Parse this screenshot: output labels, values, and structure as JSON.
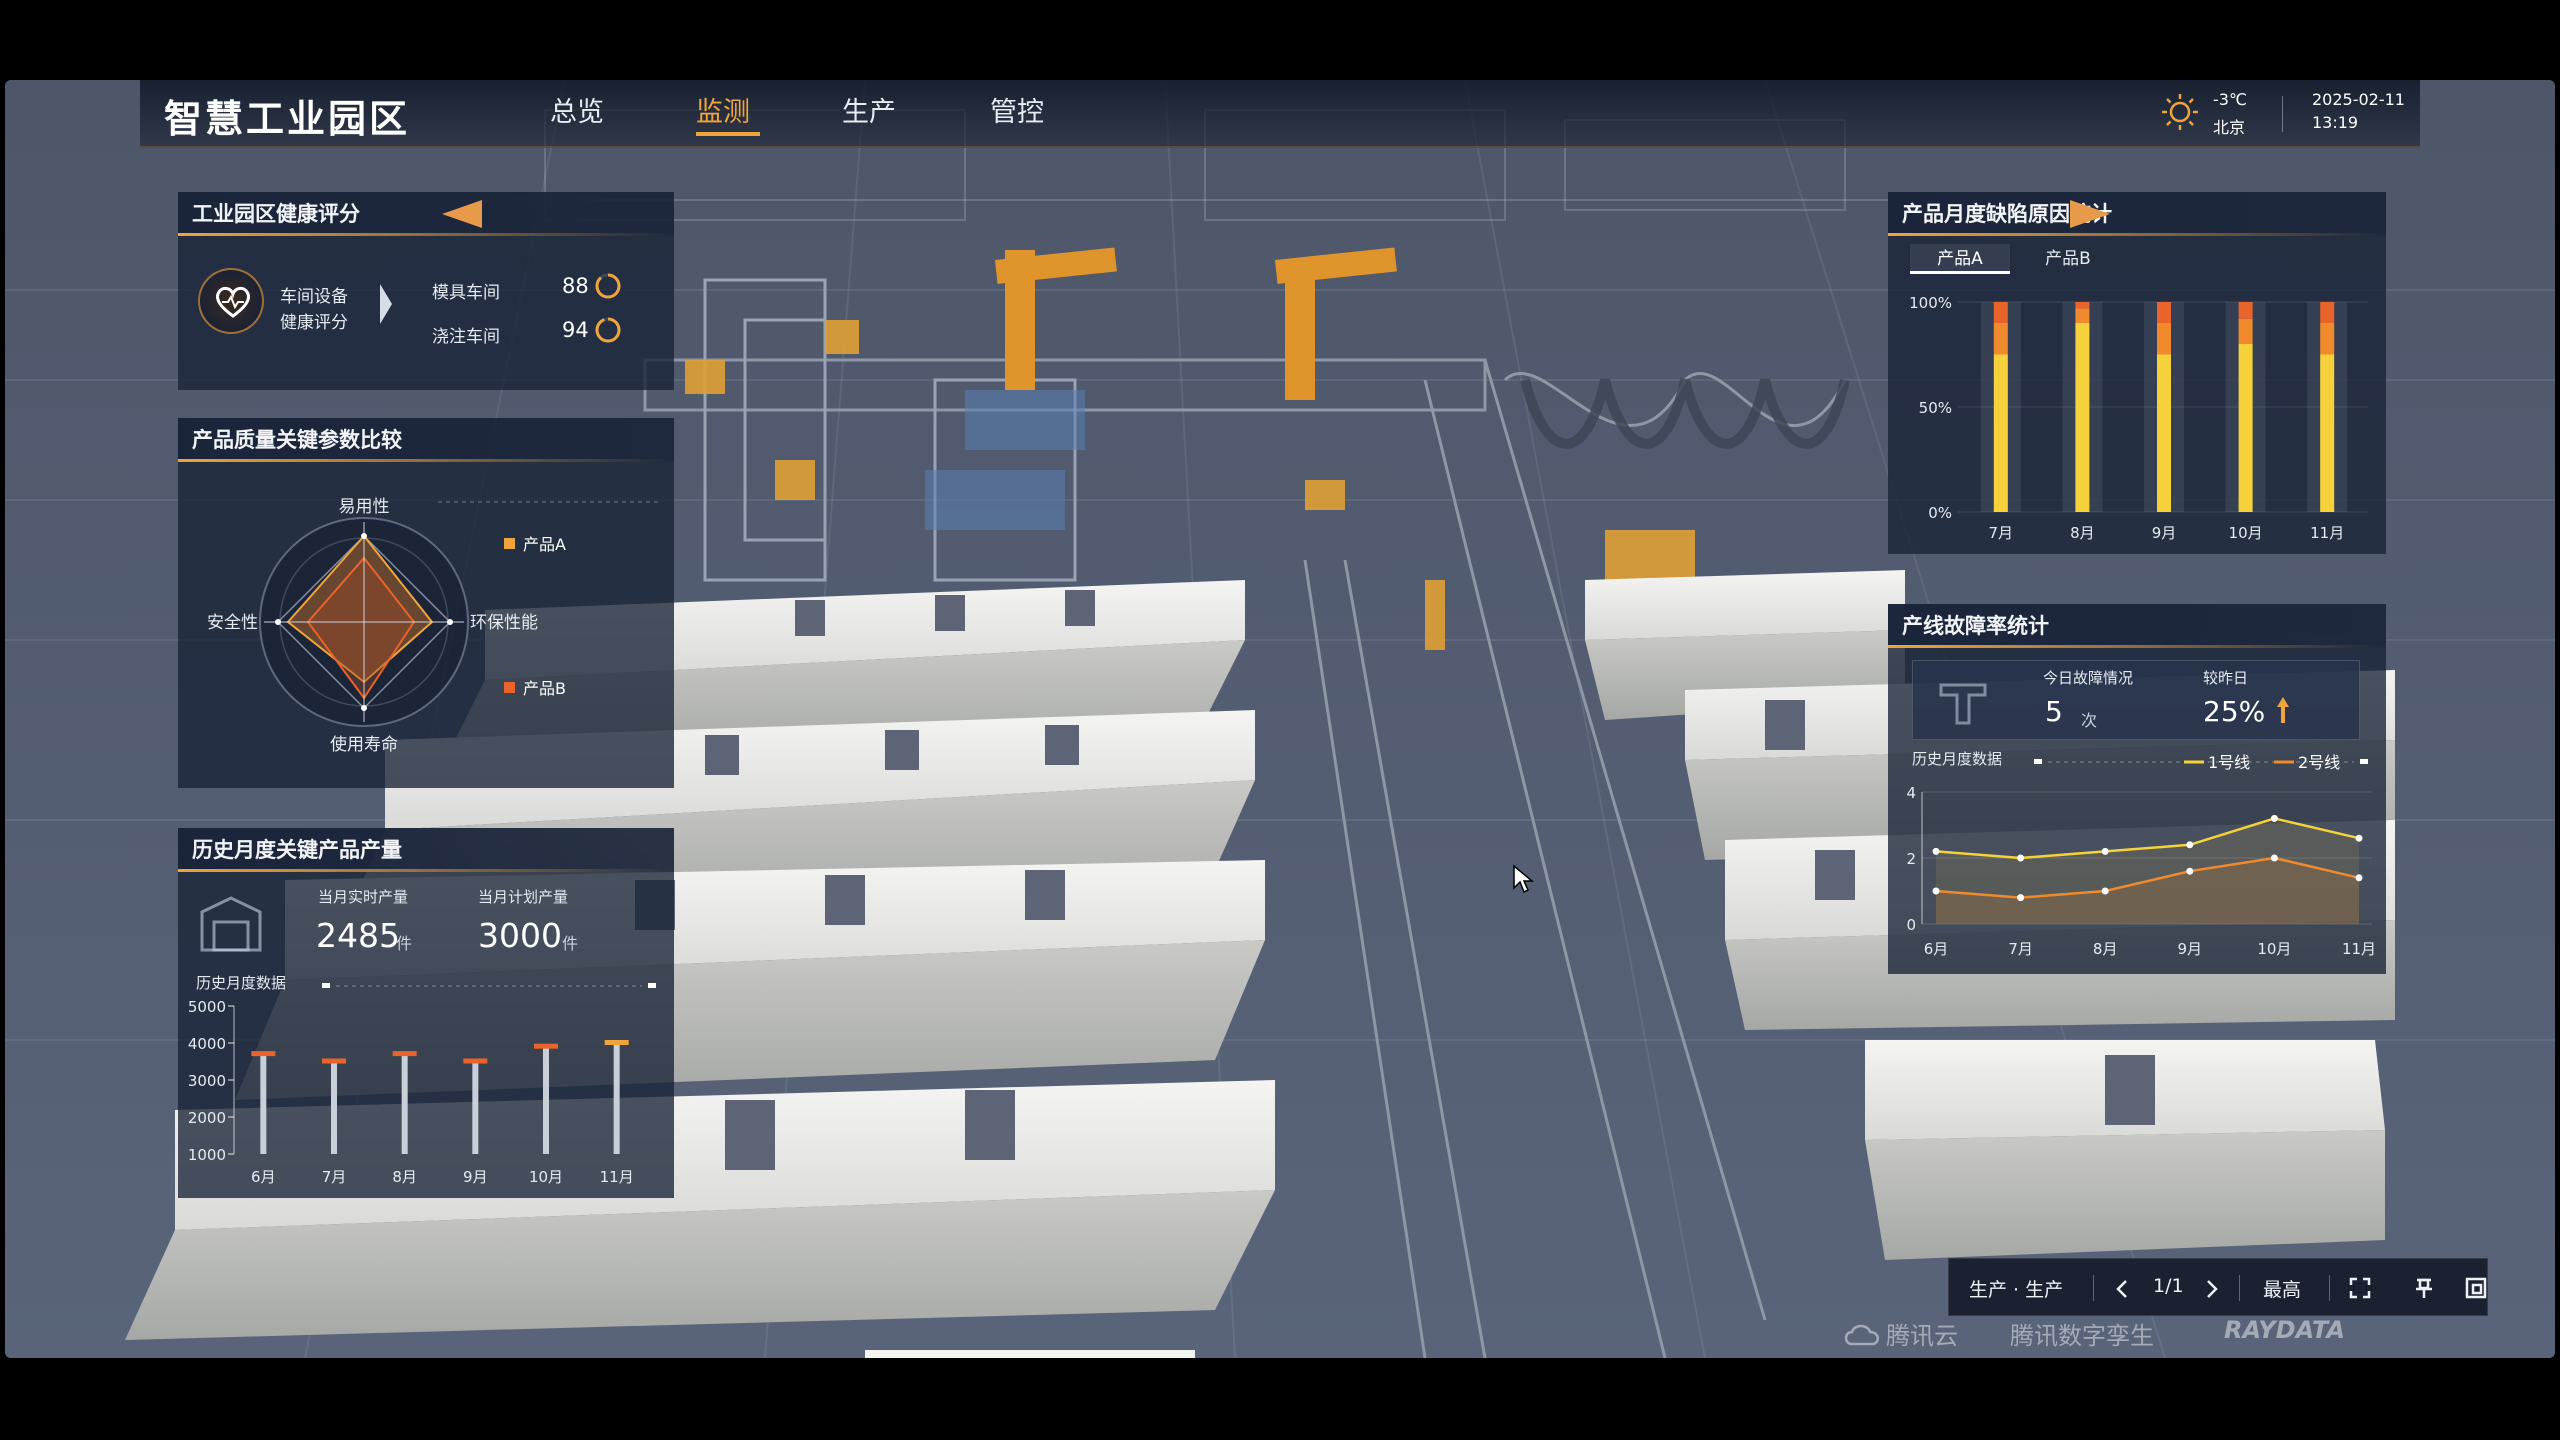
{
  "header": {
    "title": "智慧工业园区",
    "nav": [
      "总览",
      "监测",
      "生产",
      "管控"
    ],
    "active_nav": "监测",
    "weather": {
      "icon": "sun-icon",
      "temp": "-3℃",
      "city": "北京"
    },
    "date": "2025-02-11",
    "time": "13:19"
  },
  "health": {
    "title": "工业园区健康评分",
    "badge_label_1": "车间设备",
    "badge_label_2": "健康评分",
    "rows": [
      {
        "name": "模具车间",
        "score": "88"
      },
      {
        "name": "浇注车间",
        "score": "94"
      }
    ]
  },
  "radar": {
    "title": "产品质量关键参数比较",
    "axes": [
      "易用性",
      "环保性能",
      "使用寿命",
      "安全性"
    ],
    "legend": [
      "产品A",
      "产品B"
    ]
  },
  "production": {
    "title": "历史月度关键产品产量",
    "realtime_label": "当月实时产量",
    "realtime_value": "2485",
    "plan_label": "当月计划产量",
    "plan_value": "3000",
    "unit": "件",
    "history_label": "历史月度数据"
  },
  "defects": {
    "title": "产品月度缺陷原因统计",
    "tabs": [
      "产品A",
      "产品B"
    ],
    "active_tab": "产品A"
  },
  "faults": {
    "title": "产线故障率统计",
    "today_label": "今日故障情况",
    "today_value": "5",
    "today_unit": "次",
    "compare_label": "较昨日",
    "compare_value": "25%",
    "history_label": "历史月度数据",
    "legend": [
      "1号线",
      "2号线"
    ]
  },
  "toolbar": {
    "scene": "生产 · 生产",
    "page": "1/1",
    "quality": "最高"
  },
  "watermark": [
    "腾讯云",
    "腾讯数字孪生",
    "RAYDATA"
  ],
  "colors": {
    "accent": "#f0a53c",
    "orange_dark": "#e8642a",
    "yellow": "#f5d23c",
    "panel": "#18223a"
  },
  "chart_data": [
    {
      "type": "bar",
      "title": "历史月度数据",
      "categories": [
        "6月",
        "7月",
        "8月",
        "9月",
        "10月",
        "11月"
      ],
      "values": [
        3700,
        3500,
        3700,
        3500,
        3900,
        4000
      ],
      "ylim": [
        1000,
        5000
      ],
      "yticks": [
        "5000",
        "4000",
        "3000",
        "2000",
        "1000"
      ]
    },
    {
      "type": "bar",
      "title": "产品月度缺陷原因统计",
      "categories": [
        "7月",
        "8月",
        "9月",
        "10月",
        "11月"
      ],
      "yticks": [
        "100%",
        "50%",
        "0%"
      ],
      "series": [
        {
          "values": [
            75,
            90,
            75,
            80,
            75
          ]
        },
        {
          "values": [
            15,
            7,
            15,
            12,
            15
          ]
        },
        {
          "values": [
            10,
            3,
            10,
            8,
            10
          ]
        }
      ]
    },
    {
      "type": "line",
      "title": "历史月度数据",
      "categories": [
        "6月",
        "7月",
        "8月",
        "9月",
        "10月",
        "11月"
      ],
      "ylim": [
        0,
        4
      ],
      "yticks": [
        "4",
        "2",
        "0"
      ],
      "series": [
        {
          "name": "1号线",
          "values": [
            2.2,
            2.0,
            2.2,
            2.4,
            3.2,
            2.6
          ]
        },
        {
          "name": "2号线",
          "values": [
            1.0,
            0.8,
            1.0,
            1.6,
            2.0,
            1.4
          ]
        }
      ]
    }
  ]
}
